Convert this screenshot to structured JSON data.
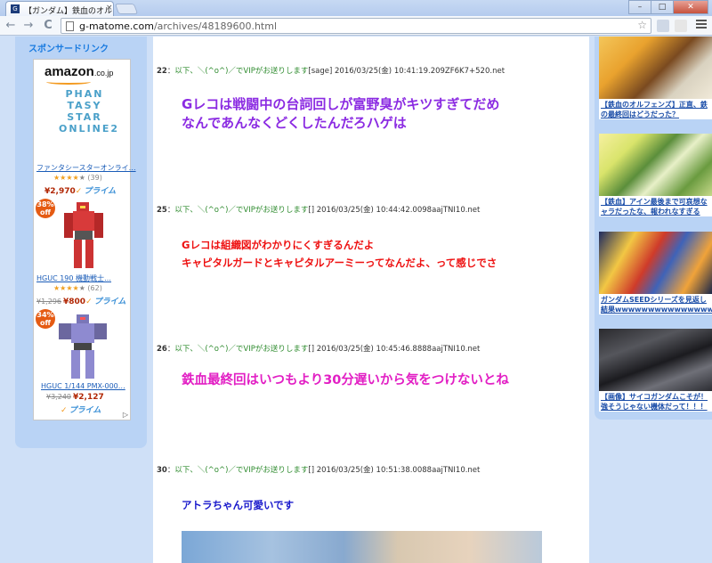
{
  "browser": {
    "tab_title": "【ガンダム】鉄血のオルフ",
    "tab_close": "×",
    "favicon": "G",
    "url_host": "g-matome.com",
    "url_path": "/archives/48189600.html",
    "win_min": "–",
    "win_max": "□",
    "win_close": "✕",
    "back": "←",
    "forward": "→",
    "reload": "C",
    "star": "☆"
  },
  "sidebar_left": {
    "sponsor_label": "スポンサードリンク",
    "amazon_logo": "amazon",
    "amazon_tld": ".co.jp",
    "pso_logo": "PHAN TASY STAR ONLINE2",
    "items": [
      {
        "title": "ファンタシースターオンライ…",
        "rating": "★★★★",
        "rating_empty": "★",
        "reviews": "(39)",
        "old_price": "",
        "price": "¥2,970",
        "prime": "プライム",
        "badge": ""
      },
      {
        "title": "HGUC 190 機動戦士…",
        "rating": "★★★★",
        "rating_empty": "★",
        "reviews": "(62)",
        "old_price": "¥1,296",
        "price": "¥800",
        "prime": "プライム",
        "badge": "38%"
      },
      {
        "title": "HGUC 1/144 PMX-000…",
        "rating": "",
        "rating_empty": "",
        "reviews": "",
        "old_price": "¥3,240",
        "price": "¥2,127",
        "prime": "プライム",
        "badge": "34%"
      }
    ],
    "badge_off": "off",
    "check": "✓",
    "ad_choice": "▷"
  },
  "posts": [
    {
      "num": "22",
      "sep": "：",
      "name": "以下、＼(^o^)／でVIPがお送りします",
      "mail": "[sage]",
      "date": "2016/03/25(金) 10:41:19.209ZF6K7+520.net",
      "body": [
        "Gレコは戦闘中の台詞回しが富野臭がキツすぎてだめ",
        "なんであんなくどくしたんだろハゲは"
      ],
      "color": "#8b2be2"
    },
    {
      "num": "25",
      "sep": "：",
      "name": "以下、＼(^o^)／でVIPがお送りします",
      "mail": "[]",
      "date": "2016/03/25(金) 10:44:42.0098aajTNI10.net",
      "body": [
        "Gレコは組織図がわかりにくすぎるんだよ",
        "キャピタルガードとキャピタルアーミーってなんだよ、って感じでさ"
      ],
      "color": "#ee1111"
    },
    {
      "num": "26",
      "sep": "：",
      "name": "以下、＼(^o^)／でVIPがお送りします",
      "mail": "[]",
      "date": "2016/03/25(金) 10:45:46.8888aajTNI10.net",
      "body": [
        "鉄血最終回はいつもより30分遅いから気をつけないとね"
      ],
      "color": "#e21fc4"
    },
    {
      "num": "30",
      "sep": "：",
      "name": "以下、＼(^o^)／でVIPがお送りします",
      "mail": "[]",
      "date": "2016/03/25(金) 10:51:38.0088aajTNI10.net",
      "body": [
        "アトラちゃん可愛いです"
      ],
      "color": "#1a1acc"
    }
  ],
  "sidebar_right": {
    "items": [
      {
        "caption_1": "【鉄血のオルフェンズ】正直、鉄",
        "caption_2": "の最終回はどうだった？"
      },
      {
        "caption_1": "【鉄血】アイン最後まで可哀想な",
        "caption_2": "ャラだったな、報われなすぎる"
      },
      {
        "caption_1": "ガンダムSEEDシリーズを見返し",
        "caption_2": "結果wwwwwwwwwwwwwwww"
      },
      {
        "caption_1": "【画像】サイコガンダムこそが！",
        "caption_2": "強そうじゃない機体だって！！！"
      }
    ]
  }
}
